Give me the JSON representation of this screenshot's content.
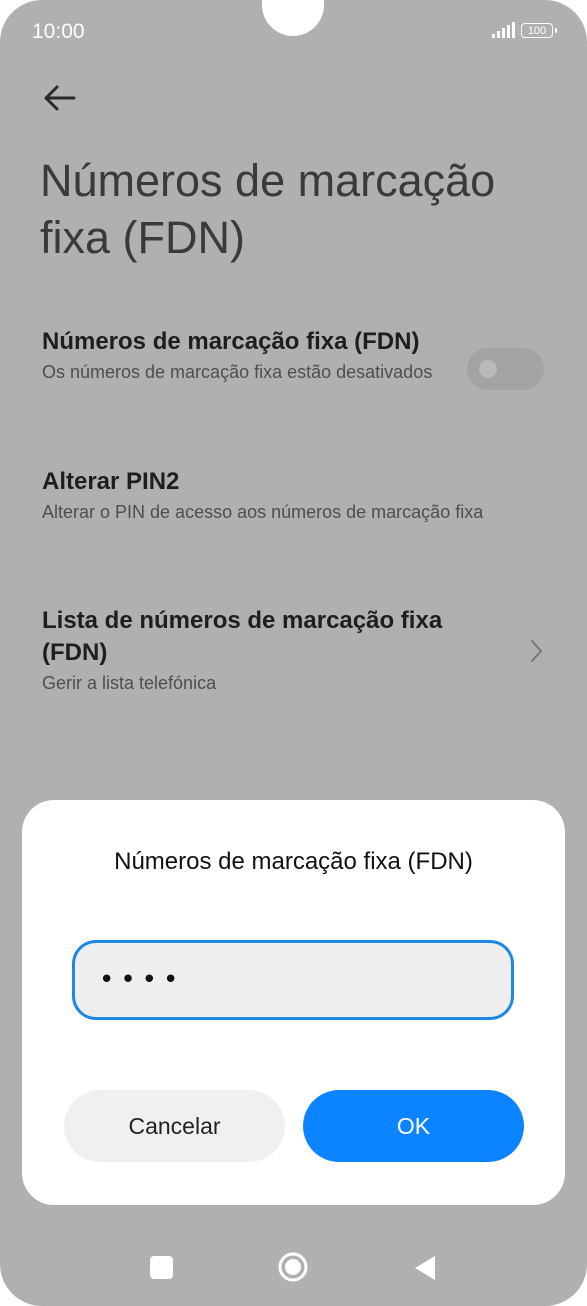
{
  "status_bar": {
    "time": "10:00",
    "battery": "100"
  },
  "header": {
    "title": "Números de marcação fixa (FDN)"
  },
  "settings": [
    {
      "title": "Números de marcação fixa (FDN)",
      "subtitle": "Os números de marcação fixa estão desativados",
      "toggle_on": false
    },
    {
      "title": "Alterar PIN2",
      "subtitle": "Alterar o PIN de acesso aos números de marcação fixa"
    },
    {
      "title": "Lista de números de marcação fixa (FDN)",
      "subtitle": "Gerir a lista telefónica"
    }
  ],
  "dialog": {
    "title": "Números de marcação fixa (FDN)",
    "pin_value": "••••",
    "cancel_label": "Cancelar",
    "ok_label": "OK"
  },
  "colors": {
    "accent": "#0d84ff",
    "input_border": "#1e88e5",
    "background_dim": "#b0b0b0"
  },
  "icons": [
    "back-arrow-icon",
    "chevron-right-icon",
    "signal-icon",
    "battery-icon",
    "recents-icon",
    "home-icon",
    "back-triangle-icon"
  ]
}
